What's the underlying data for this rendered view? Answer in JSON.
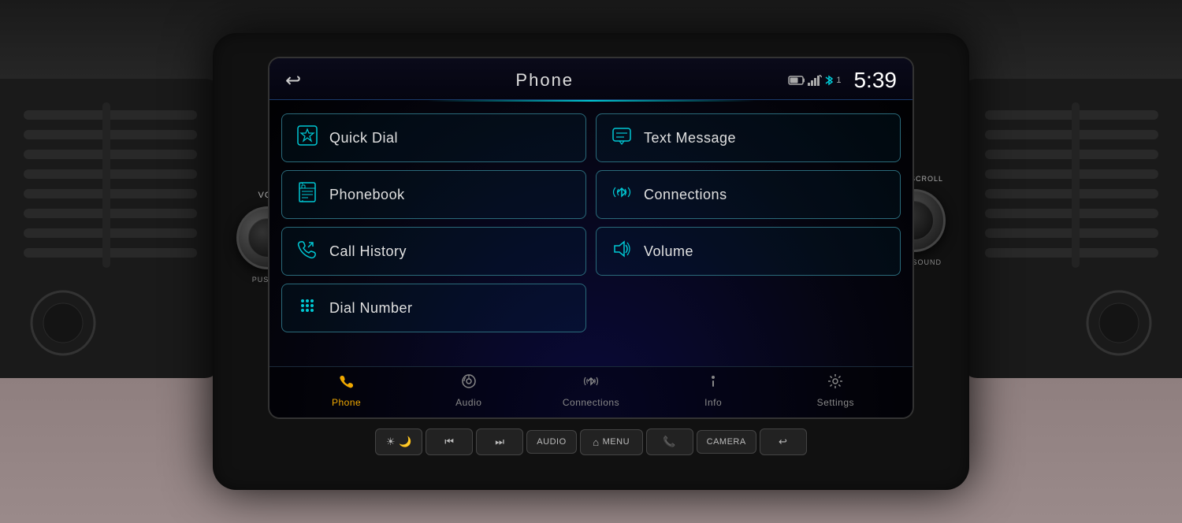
{
  "header": {
    "title": "Phone",
    "time": "5:39",
    "back_label": "↩"
  },
  "status": {
    "battery": "🔋",
    "signal": "📶",
    "bluetooth": "1"
  },
  "menu": {
    "left_items": [
      {
        "id": "quick-dial",
        "label": "Quick Dial",
        "icon": "star"
      },
      {
        "id": "phonebook",
        "label": "Phonebook",
        "icon": "book"
      },
      {
        "id": "call-history",
        "label": "Call History",
        "icon": "phone-history"
      },
      {
        "id": "dial-number",
        "label": "Dial Number",
        "icon": "dialpad"
      }
    ],
    "right_items": [
      {
        "id": "text-message",
        "label": "Text Message",
        "icon": "message"
      },
      {
        "id": "connections",
        "label": "Connections",
        "icon": "bluetooth"
      },
      {
        "id": "volume",
        "label": "Volume",
        "icon": "volume"
      }
    ]
  },
  "bottom_nav": [
    {
      "id": "phone",
      "label": "Phone",
      "active": true
    },
    {
      "id": "audio",
      "label": "Audio",
      "active": false
    },
    {
      "id": "connections",
      "label": "Connections",
      "active": false
    },
    {
      "id": "info",
      "label": "Info",
      "active": false
    },
    {
      "id": "settings",
      "label": "Settings",
      "active": false
    }
  ],
  "physical_buttons": [
    {
      "id": "brightness",
      "label": "",
      "icon": "☀"
    },
    {
      "id": "prev-track",
      "label": "",
      "icon": "⏮"
    },
    {
      "id": "next-track",
      "label": "",
      "icon": "⏭"
    },
    {
      "id": "audio-btn",
      "label": "AUDIO",
      "icon": ""
    },
    {
      "id": "menu-btn",
      "label": "⌂ MENU",
      "icon": ""
    },
    {
      "id": "phone-btn",
      "label": "",
      "icon": "📞"
    },
    {
      "id": "camera-btn",
      "label": "CAMERA",
      "icon": ""
    },
    {
      "id": "back-hw-btn",
      "label": "",
      "icon": "↩"
    }
  ],
  "knobs": {
    "left_label": "VOL",
    "left_push": "PUSH ⏻",
    "right_label": "TUNE SCROLL",
    "right_push": "PUSH SOUND"
  }
}
